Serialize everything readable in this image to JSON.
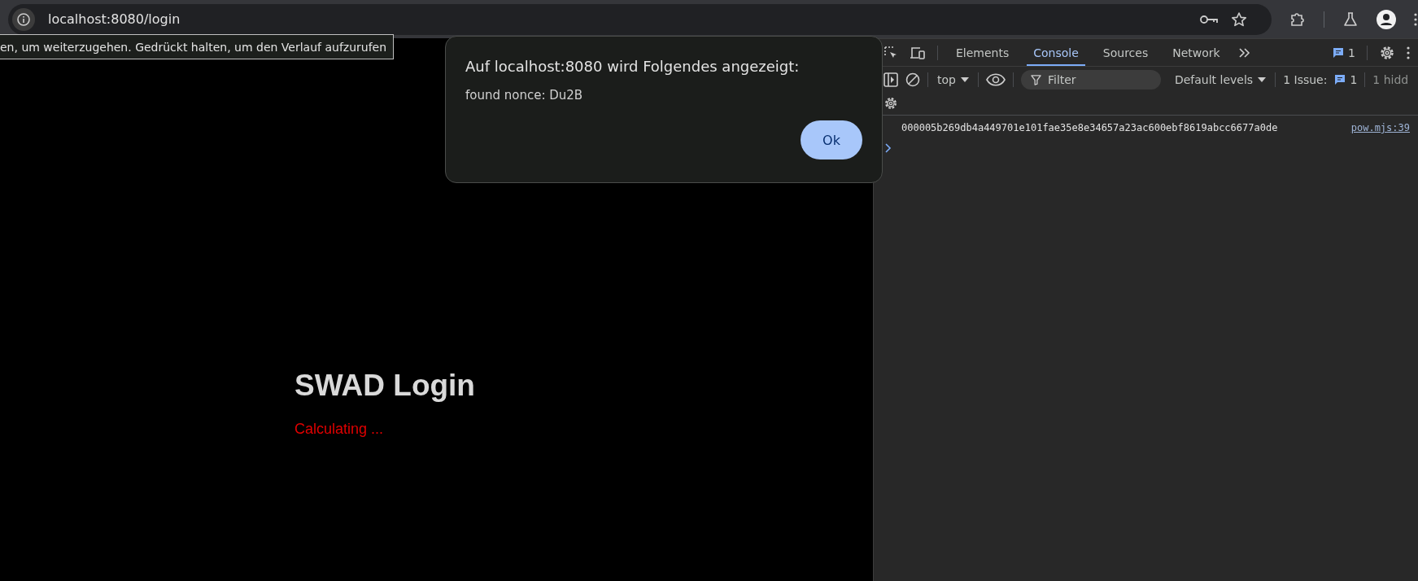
{
  "browser": {
    "address": "localhost:8080/login"
  },
  "tooltip": "en, um weiterzugehen. Gedrückt halten, um den Verlauf aufzurufen",
  "page": {
    "heading": "SWAD Login",
    "status": "Calculating ..."
  },
  "dialog": {
    "title": "Auf localhost:8080 wird Folgendes angezeigt:",
    "message": "found nonce: Du2B",
    "button": "Ok"
  },
  "devtools": {
    "tabs": [
      {
        "label": "Elements",
        "selected": false
      },
      {
        "label": "Console",
        "selected": true
      },
      {
        "label": "Sources",
        "selected": false
      },
      {
        "label": "Network",
        "selected": false
      }
    ],
    "message_count": "1",
    "context": "top",
    "filter": {
      "placeholder": "Filter"
    },
    "levels": "Default levels",
    "issues_label": "1 Issue:",
    "issues_count": "1",
    "hidden": "1 hidd",
    "console": [
      {
        "text": "000005b269db4a449701e101fae35e8e34657a23ac600ebf8619abcc6677a0de",
        "source": "pow.mjs:39"
      }
    ]
  }
}
